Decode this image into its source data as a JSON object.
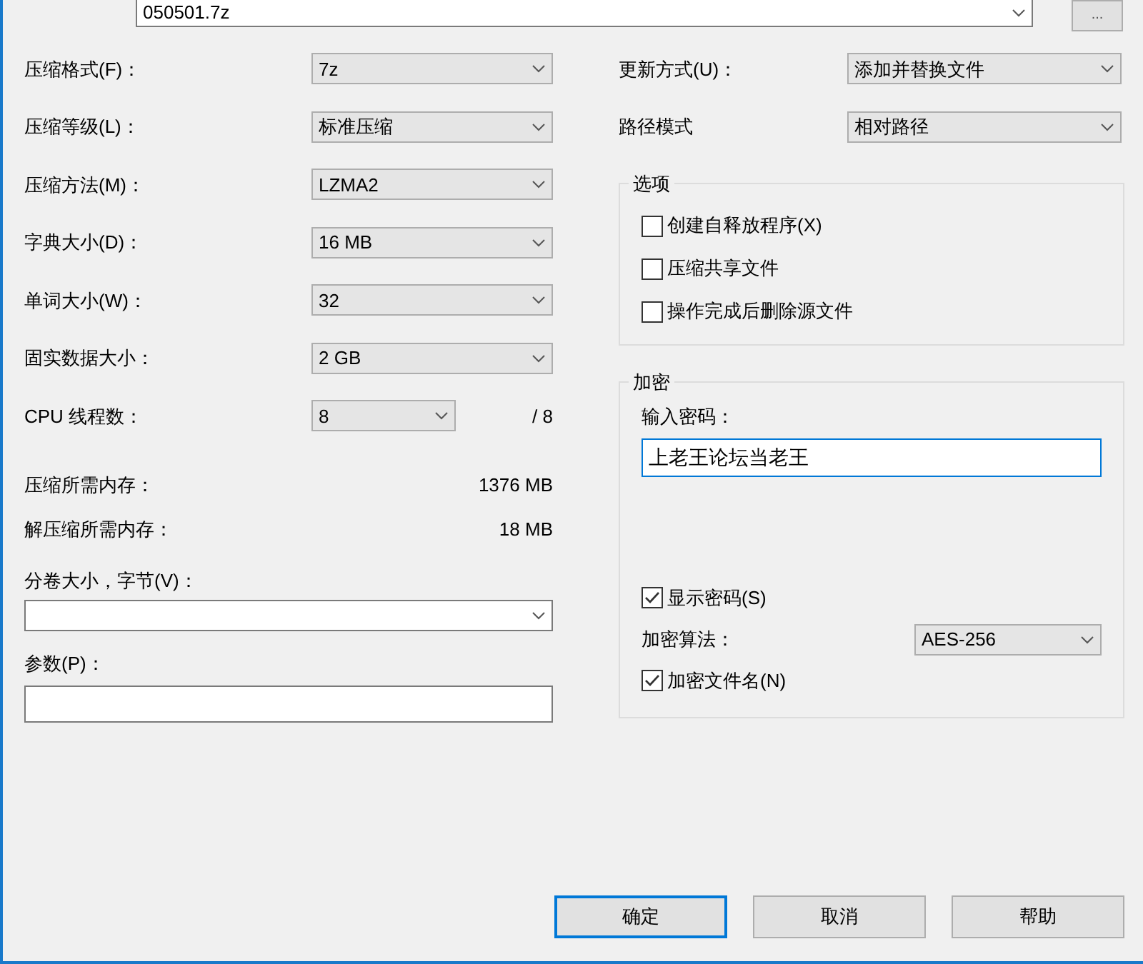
{
  "archive": {
    "value": "050501.7z"
  },
  "browse_button": "...",
  "left_settings": [
    {
      "kind": "combo",
      "label": "压缩格式(F)：",
      "value": "7z"
    },
    {
      "kind": "combo",
      "label": "压缩等级(L)：",
      "value": "标准压缩"
    },
    {
      "kind": "combo",
      "label": "压缩方法(M)：",
      "value": "LZMA2"
    },
    {
      "kind": "combo",
      "label": "字典大小(D)：",
      "value": "16 MB"
    },
    {
      "kind": "combo",
      "label": "单词大小(W)：",
      "value": "32"
    },
    {
      "kind": "combo",
      "label": "固实数据大小：",
      "value": "2 GB"
    },
    {
      "kind": "threads",
      "label": "CPU 线程数：",
      "value": "8",
      "total": "/ 8"
    },
    {
      "kind": "info",
      "label": "压缩所需内存：",
      "value": "1376 MB"
    },
    {
      "kind": "info",
      "label": "解压缩所需内存：",
      "value": "18 MB"
    }
  ],
  "volume": {
    "label": "分卷大小，字节(V)："
  },
  "parameters": {
    "label": "参数(P)："
  },
  "update_mode": {
    "label": "更新方式(U)：",
    "value": "添加并替换文件"
  },
  "path_mode": {
    "label": "路径模式",
    "value": "相对路径"
  },
  "options": {
    "title": "选项",
    "items": [
      {
        "label": "创建自释放程序(X)",
        "checked": false
      },
      {
        "label": "压缩共享文件",
        "checked": false
      },
      {
        "label": "操作完成后删除源文件",
        "checked": false
      }
    ]
  },
  "encryption": {
    "title": "加密",
    "password_label": "输入密码：",
    "password": "上老王论坛当老王",
    "show_password": {
      "label": "显示密码(S)",
      "checked": true
    },
    "method": {
      "label": "加密算法：",
      "value": "AES-256"
    },
    "encrypt_names": {
      "label": "加密文件名(N)",
      "checked": true
    }
  },
  "buttons": [
    {
      "label": "确定",
      "default": true
    },
    {
      "label": "取消",
      "default": false
    },
    {
      "label": "帮助",
      "default": false
    }
  ]
}
